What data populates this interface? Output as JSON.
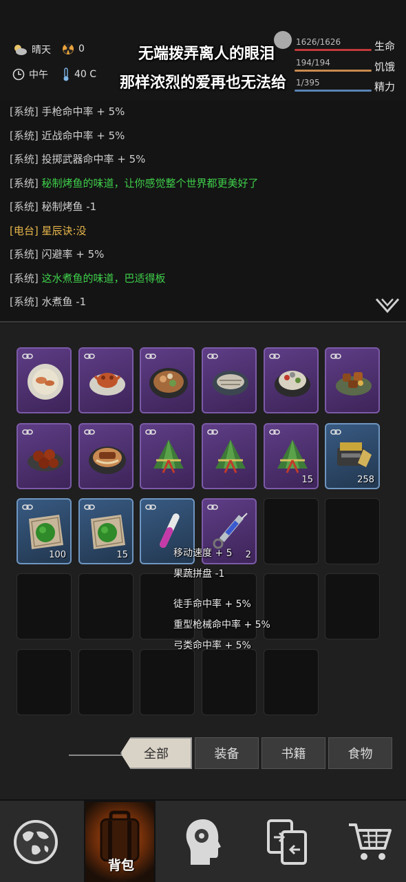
{
  "status": {
    "weather": "晴天",
    "radiation": "0",
    "time_of_day": "中午",
    "temperature": "40 C"
  },
  "lyrics": [
    "无端拨弄离人的眼泪",
    "那样浓烈的爱再也无法给"
  ],
  "vitals": [
    {
      "id": "life",
      "value": "1626/1626",
      "label": "生命"
    },
    {
      "id": "hunger",
      "value": "194/194",
      "label": "饥饿"
    },
    {
      "id": "energy",
      "value": "1/395",
      "label": "精力"
    }
  ],
  "log": [
    {
      "tag": "[系统]",
      "msg": "手枪命中率 + 5%",
      "style": "normal"
    },
    {
      "tag": "[系统]",
      "msg": "近战命中率 + 5%",
      "style": "normal"
    },
    {
      "tag": "[系统]",
      "msg": "投掷武器命中率 + 5%",
      "style": "normal"
    },
    {
      "tag": "[系统]",
      "msg": "秘制烤鱼的味道，让你感觉整个世界都更美好了",
      "style": "green"
    },
    {
      "tag": "[系统]",
      "msg": "秘制烤鱼 -1",
      "style": "normal"
    },
    {
      "tag": "[电台]",
      "msg": "星辰诀:没",
      "style": "gold"
    },
    {
      "tag": "[系统]",
      "msg": "闪避率 + 5%",
      "style": "normal"
    },
    {
      "tag": "[系统]",
      "msg": "这水煮鱼的味道，巴适得板",
      "style": "green"
    },
    {
      "tag": "[系统]",
      "msg": "水煮鱼 -1",
      "style": "normal"
    }
  ],
  "inventory": {
    "slots": [
      {
        "kind": "food",
        "icon": "fish-soup-icon",
        "count": ""
      },
      {
        "kind": "food",
        "icon": "crab-dish-icon",
        "count": ""
      },
      {
        "kind": "food",
        "icon": "stew-pot-icon",
        "count": ""
      },
      {
        "kind": "food",
        "icon": "grilled-fish-icon",
        "count": ""
      },
      {
        "kind": "food",
        "icon": "boiled-fish-icon",
        "count": ""
      },
      {
        "kind": "food",
        "icon": "braised-meat-icon",
        "count": ""
      },
      {
        "kind": "food",
        "icon": "meatballs-icon",
        "count": ""
      },
      {
        "kind": "food",
        "icon": "noodle-pot-icon",
        "count": ""
      },
      {
        "kind": "food",
        "icon": "zongzi-icon",
        "count": ""
      },
      {
        "kind": "food",
        "icon": "zongzi-icon",
        "count": ""
      },
      {
        "kind": "food",
        "icon": "zongzi-icon",
        "count": "15"
      },
      {
        "kind": "blue",
        "icon": "ammo-box-icon",
        "count": "258"
      },
      {
        "kind": "blue",
        "icon": "herb-paste-icon",
        "count": "100"
      },
      {
        "kind": "blue",
        "icon": "herb-paste-icon",
        "count": "15"
      },
      {
        "kind": "blue",
        "icon": "test-tube-icon",
        "count": ""
      },
      {
        "kind": "food",
        "icon": "syringe-icon",
        "count": "2"
      },
      {
        "kind": "empty"
      },
      {
        "kind": "empty"
      },
      {
        "kind": "empty"
      },
      {
        "kind": "empty"
      },
      {
        "kind": "empty"
      },
      {
        "kind": "empty"
      },
      {
        "kind": "empty"
      },
      {
        "kind": "empty"
      },
      {
        "kind": "empty"
      },
      {
        "kind": "empty"
      },
      {
        "kind": "empty"
      },
      {
        "kind": "empty"
      },
      {
        "kind": "empty"
      }
    ]
  },
  "tooltip": {
    "lines": [
      "移动速度 + 5",
      "果蔬拼盘 -1",
      "徒手命中率 + 5%",
      "重型枪械命中率 + 5%",
      "弓类命中率 + 5%"
    ]
  },
  "tabs": [
    {
      "id": "all",
      "label": "全部",
      "active": true
    },
    {
      "id": "equip",
      "label": "装备",
      "active": false
    },
    {
      "id": "books",
      "label": "书籍",
      "active": false
    },
    {
      "id": "food",
      "label": "食物",
      "active": false
    }
  ],
  "bottom_nav": [
    {
      "id": "map",
      "icon": "globe-icon",
      "label": ""
    },
    {
      "id": "bag",
      "icon": "backpack-icon",
      "label": "背包"
    },
    {
      "id": "skills",
      "icon": "head-gear-icon",
      "label": ""
    },
    {
      "id": "trade",
      "icon": "exchange-icon",
      "label": ""
    },
    {
      "id": "shop",
      "icon": "cart-icon",
      "label": ""
    }
  ],
  "colors": {
    "food_slot": "#5e3d86",
    "blue_slot": "#385a82",
    "log_green": "#3fd14b",
    "log_gold": "#e7b64b",
    "life_bar": "#c33a3a",
    "hunger_bar": "#c98b4e",
    "energy_bar": "#5a83b5"
  }
}
